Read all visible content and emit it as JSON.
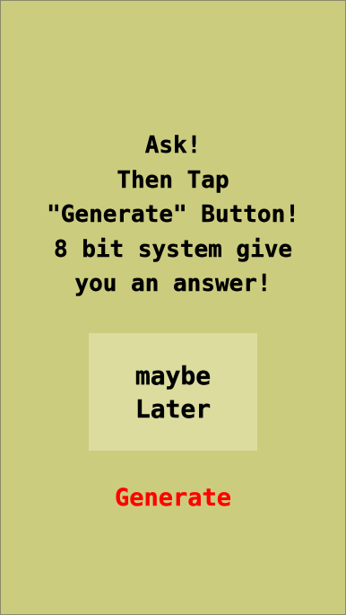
{
  "prompt": {
    "lines": [
      "Ask!",
      "Then Tap",
      "\"Generate\" Button!",
      "8 bit system give",
      "you an answer!"
    ]
  },
  "answer": {
    "lines": [
      "maybe",
      "Later"
    ]
  },
  "generate_button": {
    "label": "Generate"
  },
  "colors": {
    "background": "#cccc7f",
    "answer_box": "#dcdc9f",
    "button_text": "#ff0000",
    "text": "#000000"
  }
}
